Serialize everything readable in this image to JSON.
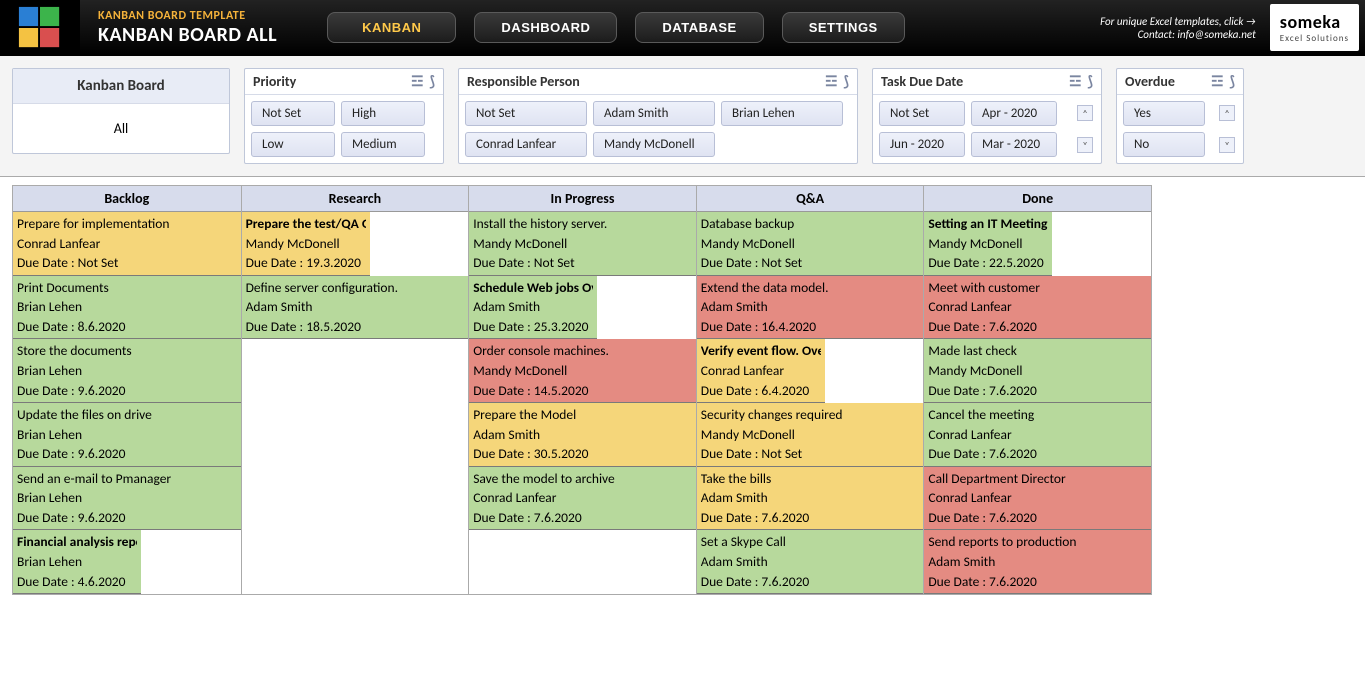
{
  "header": {
    "subtitle": "KANBAN BOARD TEMPLATE",
    "title": "KANBAN BOARD  ALL",
    "nav": {
      "kanban": "KANBAN",
      "dashboard": "DASHBOARD",
      "database": "DATABASE",
      "settings": "SETTINGS"
    },
    "topright1": "For unique Excel templates, click →",
    "topright2": "Contact: info@someka.net",
    "brand": "someka",
    "brand_sub": "Excel Solutions"
  },
  "slicers": {
    "kanban": {
      "title": "Kanban Board",
      "value": "All"
    },
    "priority": {
      "title": "Priority",
      "opts": [
        "Not Set",
        "High",
        "Low",
        "Medium"
      ]
    },
    "responsible": {
      "title": "Responsible Person",
      "opts": [
        "Not Set",
        "Adam Smith",
        "Brian Lehen",
        "Conrad Lanfear",
        "Mandy McDonell"
      ]
    },
    "duedate": {
      "title": "Task Due Date",
      "opts": [
        "Not Set",
        "Apr - 2020",
        "Jun - 2020",
        "Mar - 2020"
      ]
    },
    "overdue": {
      "title": "Overdue",
      "opts": [
        "Yes",
        "No"
      ]
    }
  },
  "columns": [
    "Backlog",
    "Research",
    "In Progress",
    "Q&A",
    "Done"
  ],
  "due_prefix": "Due Date : ",
  "cards": {
    "backlog": [
      {
        "t": "Prepare for implementation",
        "p": "Conrad Lanfear",
        "d": "Not Set",
        "c": "yellow"
      },
      {
        "t": "Print Documents",
        "p": "Brian Lehen",
        "d": "8.6.2020",
        "c": "green"
      },
      {
        "t": "Store the documents",
        "p": "Brian Lehen",
        "d": "9.6.2020",
        "c": "green"
      },
      {
        "t": "Update the files on drive",
        "p": "Brian Lehen",
        "d": "9.6.2020",
        "c": "green"
      },
      {
        "t": "Send an e-mail to Pmanager",
        "p": "Brian Lehen",
        "d": "9.6.2020",
        "c": "green"
      },
      {
        "t": "Financial analysis report Overdue !",
        "p": "Brian Lehen",
        "d": "4.6.2020",
        "c": "green",
        "o": true
      }
    ],
    "research": [
      {
        "t": "Prepare the test/QA Overdue !",
        "p": "Mandy McDonell",
        "d": "19.3.2020",
        "c": "yellow",
        "o": true
      },
      {
        "t": "Define server configuration.",
        "p": "Adam Smith",
        "d": "18.5.2020",
        "c": "green"
      }
    ],
    "inprogress": [
      {
        "t": "Install the history server.",
        "p": "Mandy McDonell",
        "d": "Not Set",
        "c": "green"
      },
      {
        "t": "Schedule Web jobs Overdue !",
        "p": "Adam Smith",
        "d": "25.3.2020",
        "c": "green",
        "o": true
      },
      {
        "t": "Order console machines.",
        "p": "Mandy McDonell",
        "d": "14.5.2020",
        "c": "red"
      },
      {
        "t": "Prepare the Model",
        "p": "Adam Smith",
        "d": "30.5.2020",
        "c": "yellow"
      },
      {
        "t": "Save the model to archive",
        "p": "Conrad Lanfear",
        "d": "7.6.2020",
        "c": "green"
      }
    ],
    "qa": [
      {
        "t": "Database backup",
        "p": "Mandy McDonell",
        "d": "Not Set",
        "c": "green"
      },
      {
        "t": "Extend the data model.",
        "p": "Adam Smith",
        "d": "16.4.2020",
        "c": "red"
      },
      {
        "t": "Verify event flow. Overdue !",
        "p": "Conrad Lanfear",
        "d": "6.4.2020",
        "c": "yellow",
        "o": true
      },
      {
        "t": "Security changes required",
        "p": "Mandy McDonell",
        "d": "Not Set",
        "c": "yellow"
      },
      {
        "t": "Take the bills",
        "p": "Adam Smith",
        "d": "7.6.2020",
        "c": "yellow"
      },
      {
        "t": "Set a Skype Call",
        "p": "Adam Smith",
        "d": "7.6.2020",
        "c": "green"
      }
    ],
    "done": [
      {
        "t": "Setting an IT Meeting Overdue !",
        "p": "Mandy McDonell",
        "d": "22.5.2020",
        "c": "green",
        "o": true
      },
      {
        "t": "Meet with customer",
        "p": "Conrad Lanfear",
        "d": "7.6.2020",
        "c": "red"
      },
      {
        "t": "Made last check",
        "p": "Mandy McDonell",
        "d": "7.6.2020",
        "c": "green"
      },
      {
        "t": "Cancel the meeting",
        "p": "Conrad Lanfear",
        "d": "7.6.2020",
        "c": "green"
      },
      {
        "t": "Call Department Director",
        "p": "Conrad Lanfear",
        "d": "7.6.2020",
        "c": "red"
      },
      {
        "t": "Send reports to production",
        "p": "Adam Smith",
        "d": "7.6.2020",
        "c": "red"
      }
    ]
  }
}
